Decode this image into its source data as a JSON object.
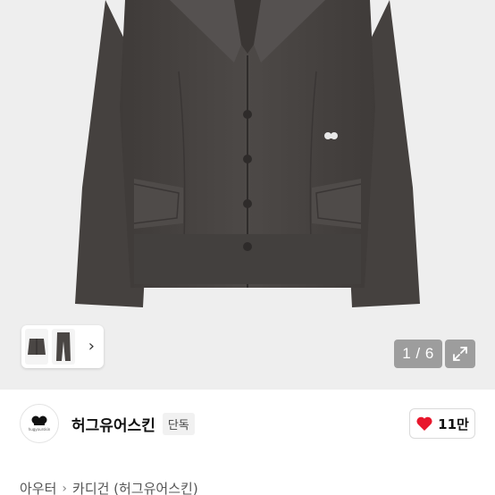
{
  "gallery": {
    "counter": "1 / 6",
    "thumb_chevron": "›"
  },
  "brand": {
    "logo_text": "hugyourskin",
    "name": "허그유어스킨",
    "badge": "단독"
  },
  "like": {
    "count": "11만",
    "heart_color": "#e8172c"
  },
  "breadcrumb": {
    "items": [
      "아우터",
      "카디건 (허그유어스킨)"
    ],
    "separator": "›"
  },
  "colors": {
    "garment": "#4a4644",
    "background": "#eeeeee"
  }
}
